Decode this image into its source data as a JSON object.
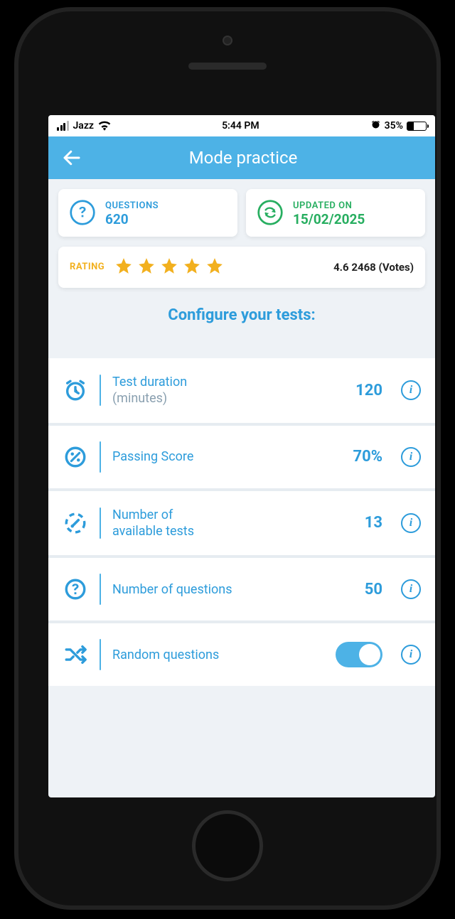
{
  "status": {
    "carrier": "Jazz",
    "time": "5:44 PM",
    "battery_pct": "35%"
  },
  "header": {
    "title": "Mode practice"
  },
  "questions_card": {
    "label": "QUESTIONS",
    "value": "620"
  },
  "updated_card": {
    "label": "UPDATED ON",
    "value": "15/02/2025"
  },
  "rating": {
    "label": "RATING",
    "text": "4.6 2468 (Votes)"
  },
  "section_heading": "Configure your tests:",
  "config": {
    "duration": {
      "label": "Test duration",
      "sub": "(minutes)",
      "value": "120"
    },
    "passing": {
      "label": "Passing Score",
      "value": "70%"
    },
    "tests": {
      "label_line1": "Number of",
      "label_line2": "available tests",
      "value": "13"
    },
    "questions": {
      "label": "Number of questions",
      "value": "50"
    },
    "random": {
      "label": "Random questions",
      "on": true
    }
  }
}
